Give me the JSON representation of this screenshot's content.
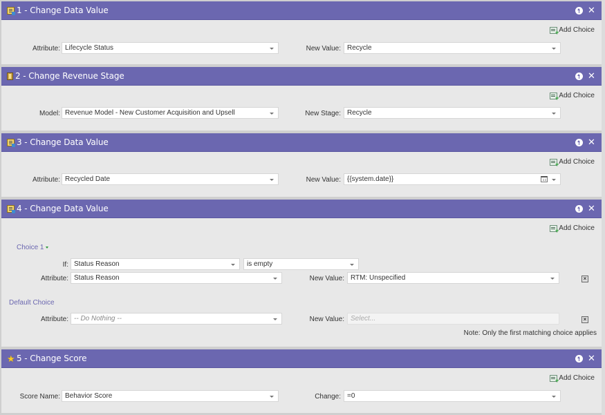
{
  "add_choice_label": "Add Choice",
  "icons": {
    "data_value": "change-data-value-icon",
    "revenue": "revenue-stage-icon",
    "score": "star-icon",
    "move_up": "move-up-icon",
    "close": "close-icon",
    "add_choice": "add-choice-icon",
    "calendar": "calendar-icon",
    "delete": "delete-choice-icon"
  },
  "colors": {
    "header": "#6b67b0",
    "body": "#e8e8e8",
    "link": "#6b67b0"
  },
  "steps": [
    {
      "title": "1 - Change Data Value",
      "left_label": "Attribute:",
      "left_value": "Lifecycle Status",
      "right_label": "New Value:",
      "right_value": "Recycle"
    },
    {
      "title": "2 - Change Revenue Stage",
      "left_label": "Model:",
      "left_value": "Revenue Model - New Customer Acquisition and Upsell",
      "right_label": "New Stage:",
      "right_value": "Recycle"
    },
    {
      "title": "3 - Change Data Value",
      "left_label": "Attribute:",
      "left_value": "Recycled Date",
      "right_label": "New Value:",
      "right_value": "{{system.date}}"
    },
    {
      "title": "4 - Change Data Value",
      "choice1_label": "Choice 1",
      "if_label": "If:",
      "if_field": "Status Reason",
      "if_operator": "is empty",
      "attr_label": "Attribute:",
      "attr_value": "Status Reason",
      "newvalue_label": "New Value:",
      "newvalue_value": "RTM: Unspecified",
      "default_label": "Default Choice",
      "default_attr_label": "Attribute:",
      "default_attr_value": "-- Do Nothing --",
      "default_newvalue_label": "New Value:",
      "default_newvalue_placeholder": "Select...",
      "note": "Note: Only the first matching choice applies"
    },
    {
      "title": "5 - Change Score",
      "left_label": "Score Name:",
      "left_value": "Behavior Score",
      "right_label": "Change:",
      "right_value": "=0"
    }
  ]
}
